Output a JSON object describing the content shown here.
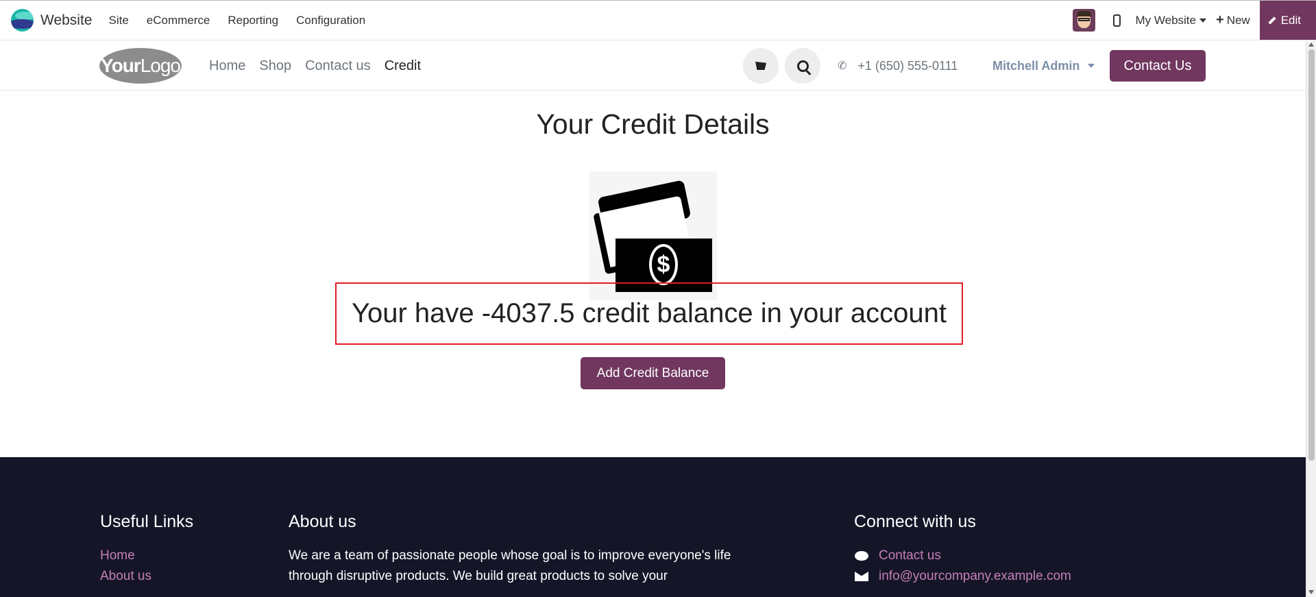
{
  "topbar": {
    "app_name": "Website",
    "menu": [
      "Site",
      "eCommerce",
      "Reporting",
      "Configuration"
    ],
    "website_selector": "My Website",
    "new_label": "New",
    "edit_label": "Edit"
  },
  "header": {
    "logo_text_bold": "Your",
    "logo_text_light": "Logo",
    "nav": [
      "Home",
      "Shop",
      "Contact us",
      "Credit"
    ],
    "active_nav": "Credit",
    "phone": "+1 (650) 555-0111",
    "user": "Mitchell Admin",
    "contact_button": "Contact Us"
  },
  "main": {
    "title": "Your Credit Details",
    "balance_text": "Your have -4037.5 credit balance in your account",
    "add_button": "Add Credit Balance"
  },
  "footer": {
    "useful_links_heading": "Useful Links",
    "useful_links": [
      "Home",
      "About us"
    ],
    "about_heading": "About us",
    "about_text": "We are a team of passionate people whose goal is to improve everyone's life through disruptive products. We build great products to solve your",
    "connect_heading": "Connect with us",
    "contact_link": "Contact us",
    "email": "info@yourcompany.example.com"
  },
  "colors": {
    "brand_purple": "#71375f",
    "footer_bg": "#141628",
    "footer_link": "#c77fb6",
    "highlight_red": "#e21b23"
  }
}
